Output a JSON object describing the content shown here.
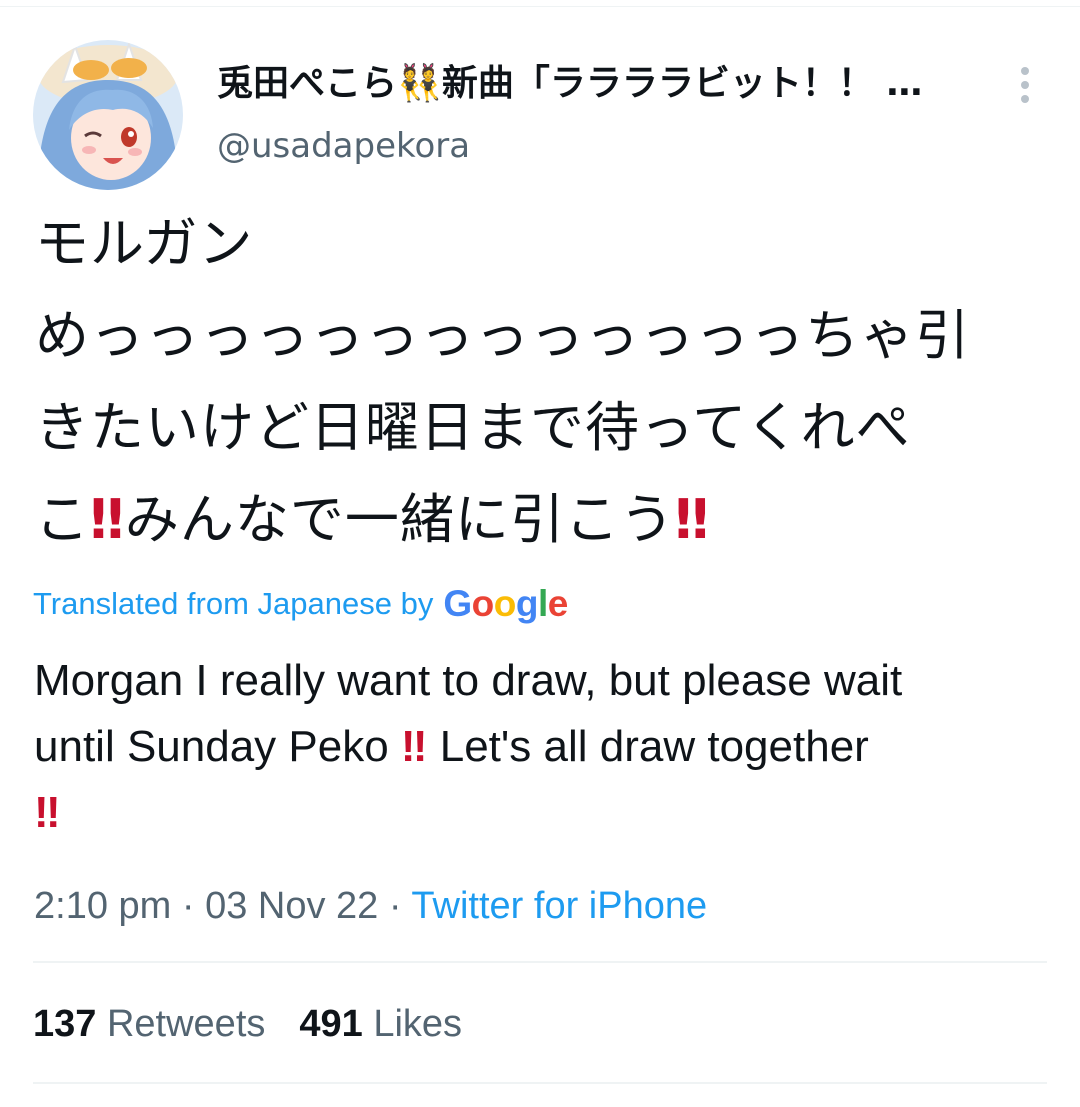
{
  "tweet": {
    "author": {
      "display_name": "兎田ぺこら👯新曲「ララララビット！！ …",
      "handle": "@usadapekora",
      "avatar_icon": "avatar-image",
      "more_icon": "more-vertical-icon"
    },
    "text_lines": [
      "モルガン",
      "めっっっっっっっっっっっっっちゃ引",
      "きたいけど日曜日まで待ってくれぺ"
    ],
    "text_last_line": {
      "part1": "こ",
      "bang1": "‼",
      "part2": "みんなで一緒に引こう",
      "bang2": "‼"
    },
    "translation_notice": {
      "label": "Translated from Japanese by",
      "provider_letters": [
        "G",
        "o",
        "o",
        "g",
        "l",
        "e"
      ],
      "provider_colors": [
        "#4285f4",
        "#ea4335",
        "#fbbc05",
        "#4285f4",
        "#34a853",
        "#ea4335"
      ]
    },
    "translation": {
      "line1": "Morgan I really want to draw, but please wait",
      "line2_part1": "until Sunday Peko",
      "line2_bang": "‼",
      "line2_part2": "Let's all draw together",
      "line3_bang": "‼"
    },
    "meta": {
      "time": "2:10 pm",
      "separator": "·",
      "date": "03 Nov 22",
      "source": "Twitter for iPhone"
    },
    "stats": {
      "retweets_count": "137",
      "retweets_label": "Retweets",
      "likes_count": "491",
      "likes_label": "Likes"
    }
  },
  "colors": {
    "link_blue": "#1d9bf0",
    "secondary_gray": "#536471",
    "bang_red": "#c8102e"
  }
}
